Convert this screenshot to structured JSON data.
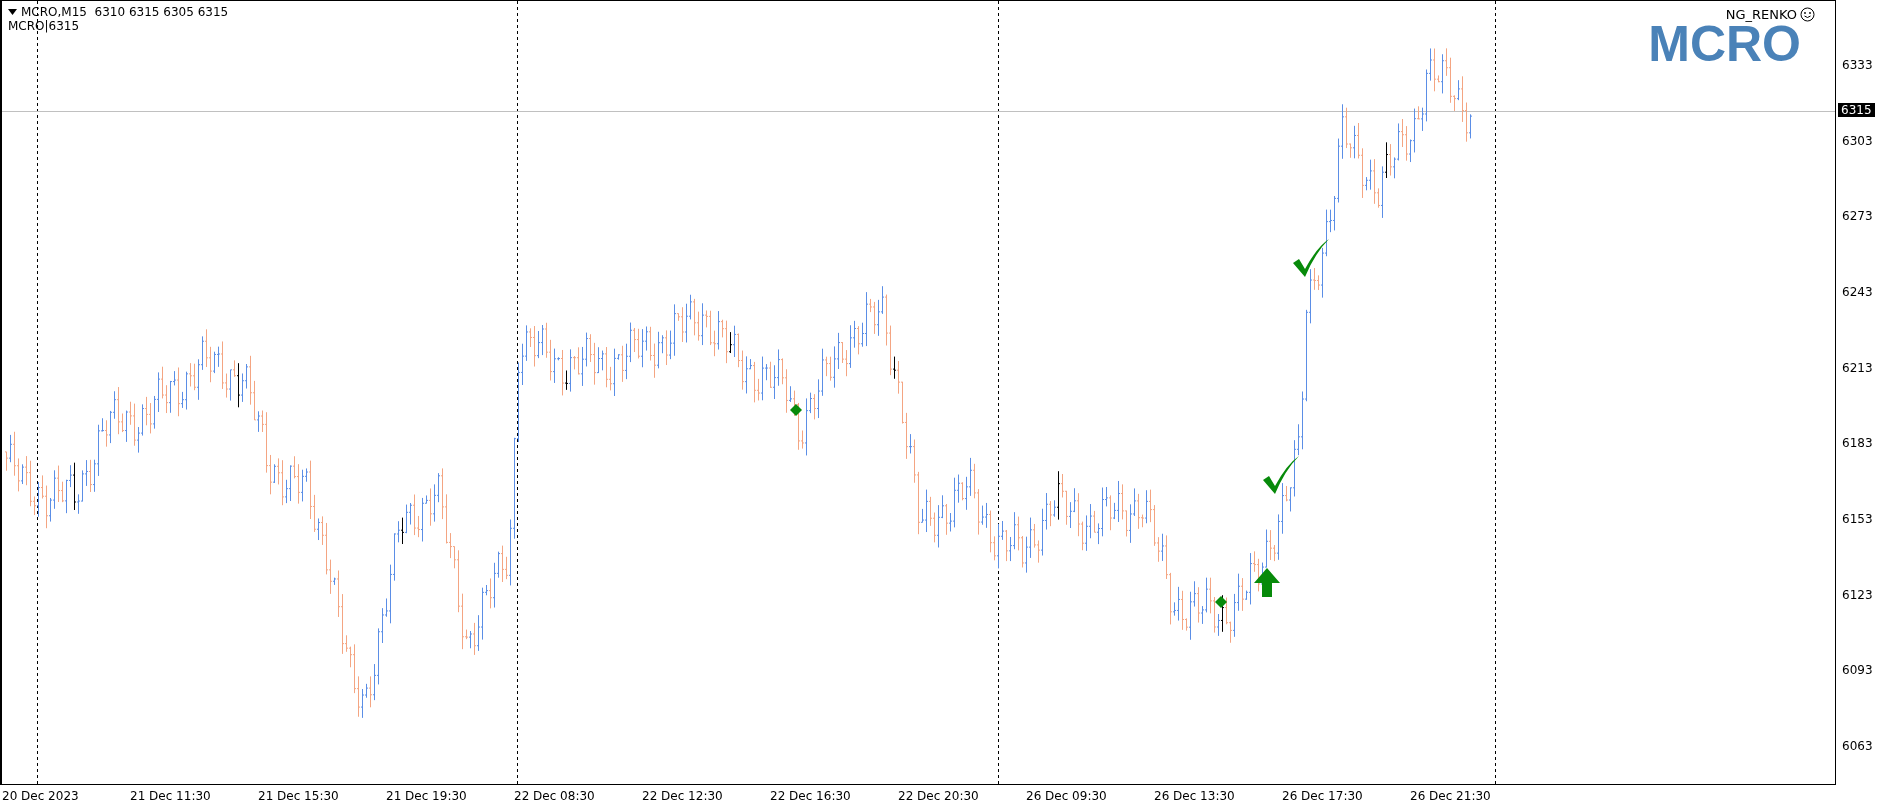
{
  "header": {
    "symbol_line": "MCRO,M15  6310 6315 6305 6315",
    "sub_line": "MCRO|6315"
  },
  "indicator": {
    "name": "NG_RENKO",
    "watermark": "MCRO"
  },
  "price_axis": {
    "ticks": [
      "6333",
      "6303",
      "6273",
      "6243",
      "6213",
      "6183",
      "6153",
      "6123",
      "6093",
      "6063"
    ],
    "current_price": "6315"
  },
  "time_axis": {
    "labels": [
      "20 Dec 2023",
      "21 Dec 11:30",
      "21 Dec 15:30",
      "21 Dec 19:30",
      "22 Dec 08:30",
      "22 Dec 12:30",
      "22 Dec 16:30",
      "22 Dec 20:30",
      "26 Dec 09:30",
      "26 Dec 13:30",
      "26 Dec 17:30",
      "26 Dec 21:30"
    ]
  }
}
